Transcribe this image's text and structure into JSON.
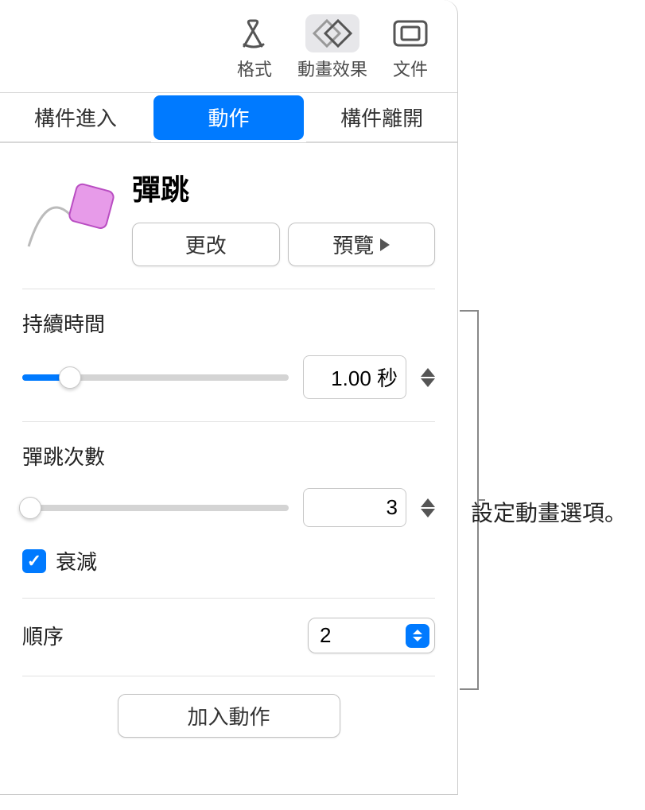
{
  "toolbar": {
    "format": "格式",
    "animate": "動畫效果",
    "document": "文件"
  },
  "tabs": {
    "build_in": "構件進入",
    "action": "動作",
    "build_out": "構件離開"
  },
  "effect": {
    "name": "彈跳",
    "change_label": "更改",
    "preview_label": "預覽"
  },
  "duration": {
    "label": "持續時間",
    "value": "1.00 秒",
    "slider_percent": 18
  },
  "bounces": {
    "label": "彈跳次數",
    "value": "3",
    "slider_percent": 3,
    "decay_label": "衰減",
    "decay_checked": true
  },
  "order": {
    "label": "順序",
    "value": "2"
  },
  "add_action_label": "加入動作",
  "callout": "設定動畫選項。"
}
